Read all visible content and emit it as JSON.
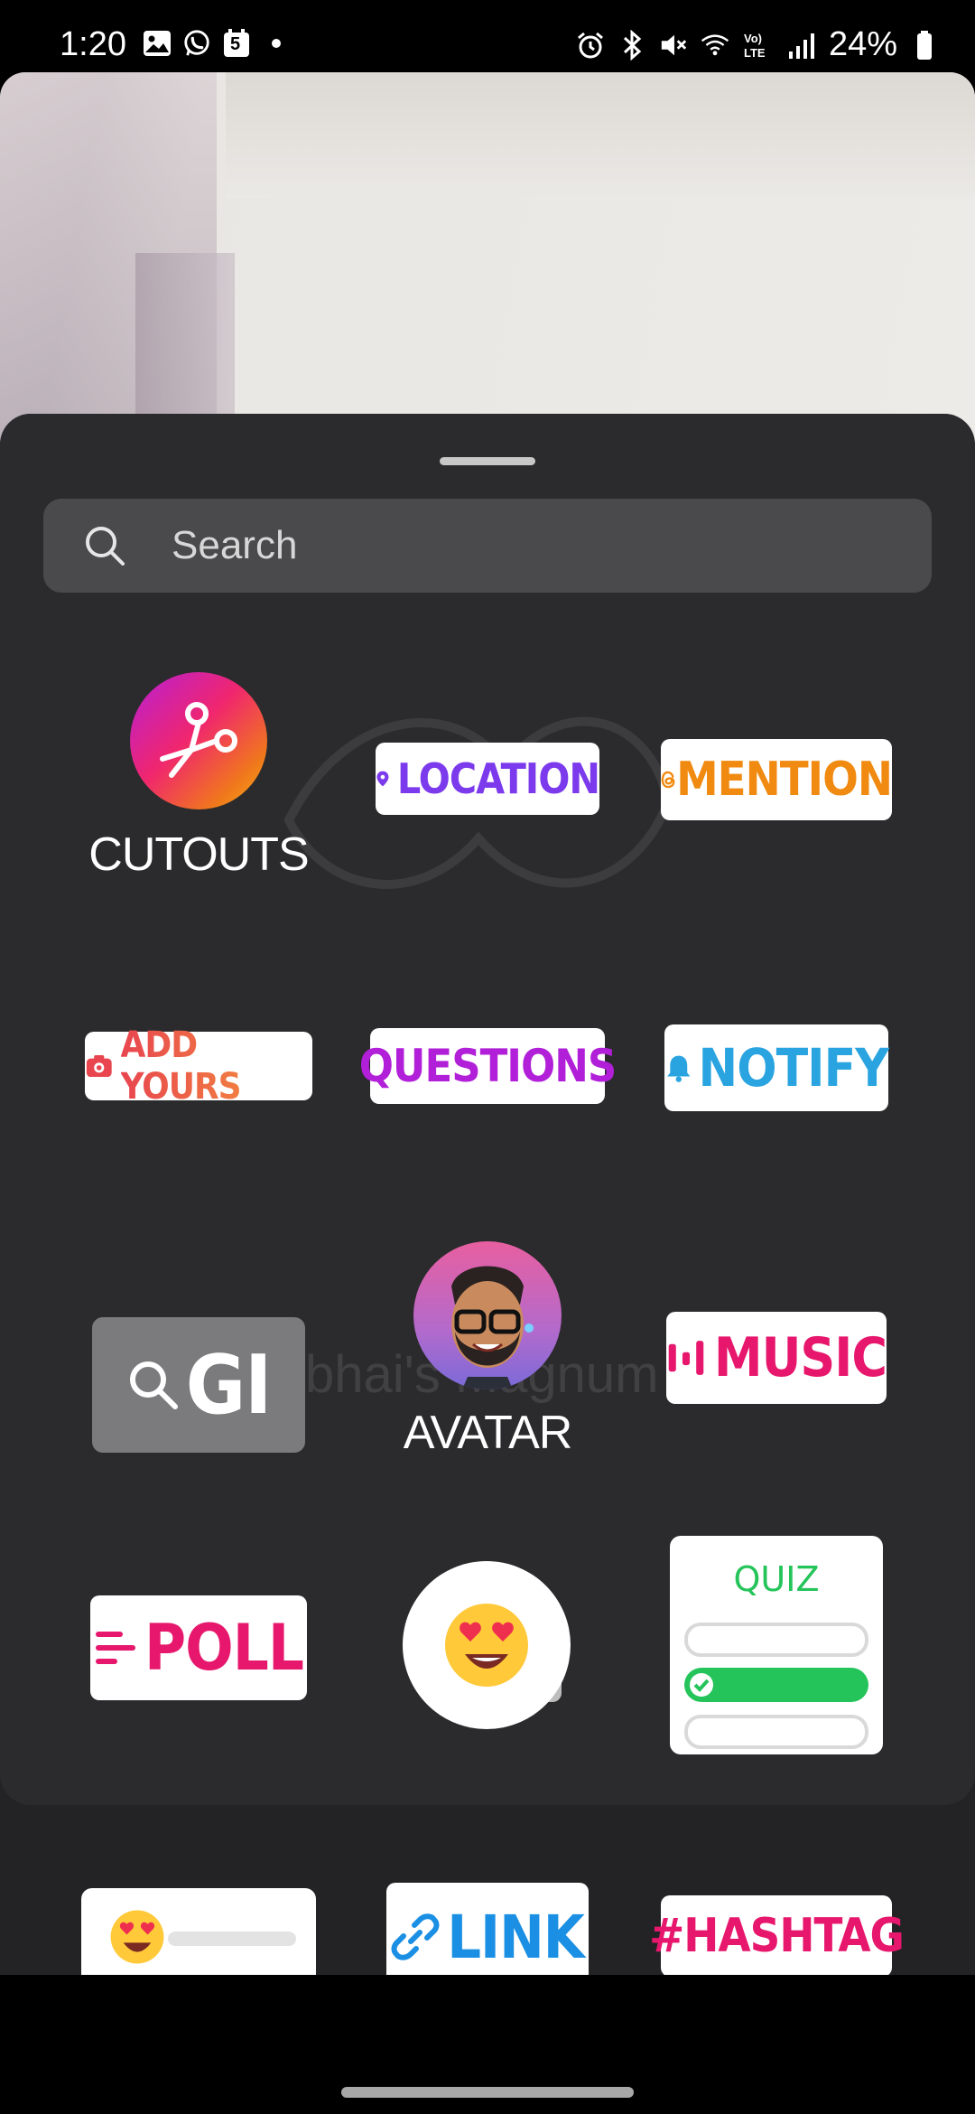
{
  "status_bar": {
    "time": "1:20",
    "notification_badge": "5",
    "battery": "24%"
  },
  "search": {
    "placeholder": "Search"
  },
  "stickers": {
    "cutouts": "CUTOUTS",
    "location": "LOCATION",
    "mention": "MENTION",
    "add_yours": "ADD YOURS",
    "questions": "QUESTIONS",
    "notify": "NOTIFY",
    "gif": "GI",
    "avatar": "AVATAR",
    "music": "MUSIC",
    "poll": "POLL",
    "quiz": "QUIZ",
    "link": "LINK",
    "hashtag": "#HASHTAG"
  },
  "colors": {
    "location": "#7c3aed",
    "mention": "#f08a10",
    "add_yours_start": "#e8454f",
    "add_yours_end": "#f59e3a",
    "questions": "#b11fd8",
    "notify": "#2aa4e0",
    "music": "#e6176c",
    "poll": "#e6176c",
    "quiz": "#25c45a",
    "link": "#1a8fe3",
    "hashtag": "#e6176c"
  },
  "background_caption": "Majnubhai's Magnum Op"
}
